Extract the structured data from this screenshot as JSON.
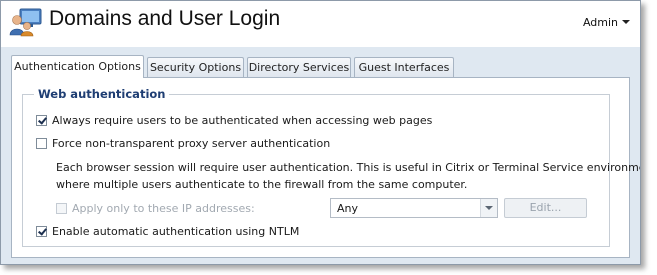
{
  "header": {
    "title": "Domains and User Login",
    "user_menu": "Admin",
    "icon": "users-monitor-icon"
  },
  "tabs": [
    {
      "label": "Authentication Options",
      "active": true
    },
    {
      "label": "Security Options",
      "active": false
    },
    {
      "label": "Directory Services",
      "active": false
    },
    {
      "label": "Guest Interfaces",
      "active": false
    }
  ],
  "web_auth": {
    "legend": "Web authentication",
    "always_require": {
      "label": "Always require users to be authenticated when accessing web pages",
      "checked": true
    },
    "force_proxy": {
      "label": "Force non-transparent proxy server authentication",
      "checked": false
    },
    "description_line1": "Each browser session will require user authentication. This is useful in Citrix or Terminal Service environments,",
    "description_line2": "where multiple users authenticate to the firewall from the same computer.",
    "apply_ip": {
      "label": "Apply only to these IP addresses:",
      "checked": false,
      "disabled": true
    },
    "ip_select_value": "Any",
    "edit_button": "Edit...",
    "ntlm": {
      "label": "Enable automatic authentication using NTLM",
      "checked": true
    }
  }
}
